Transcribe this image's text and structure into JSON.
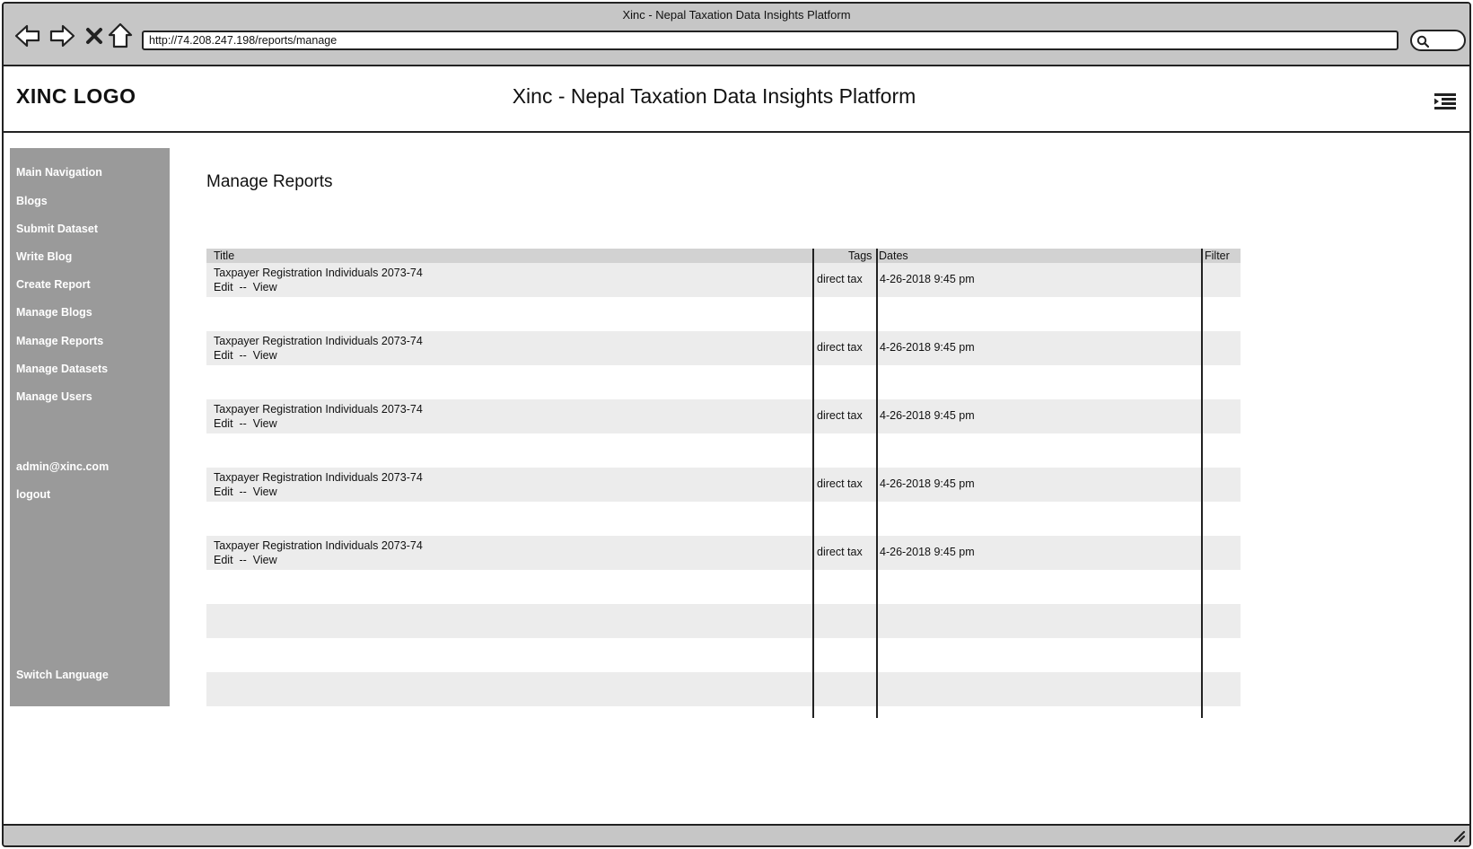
{
  "browser": {
    "window_title": "Xinc - Nepal Taxation Data Insights Platform",
    "url": "http://74.208.247.198/reports/manage",
    "icons": [
      "back-arrow-icon",
      "forward-arrow-icon",
      "stop-icon",
      "home-icon",
      "search-icon"
    ]
  },
  "header": {
    "logo": "XINC LOGO",
    "title": "Xinc - Nepal Taxation Data Insights Platform",
    "menu_icon": "menu-list-icon"
  },
  "sidebar": {
    "items": [
      {
        "label": "Main Navigation"
      },
      {
        "label": "Blogs"
      },
      {
        "label": "Submit Dataset"
      },
      {
        "label": "Write Blog"
      },
      {
        "label": "Create Report"
      },
      {
        "label": "Manage Blogs"
      },
      {
        "label": "Manage Reports"
      },
      {
        "label": "Manage Datasets"
      },
      {
        "label": "Manage Users"
      }
    ],
    "user_email": "admin@xinc.com",
    "logout": "logout",
    "switch_language": "Switch Language"
  },
  "main": {
    "page_title": "Manage Reports",
    "table": {
      "columns": {
        "title": "Title",
        "tags": "Tags",
        "dates": "Dates",
        "filter": "Filter"
      },
      "rows": [
        {
          "title": "Taxpayer Registration Individuals 2073-74",
          "edit": "Edit",
          "sep": "--",
          "view": "View",
          "tags": "direct tax",
          "date": "4-26-2018 9:45 pm"
        },
        {
          "title": "Taxpayer Registration Individuals 2073-74",
          "edit": "Edit",
          "sep": "--",
          "view": "View",
          "tags": "direct tax",
          "date": "4-26-2018 9:45 pm"
        },
        {
          "title": "Taxpayer Registration Individuals 2073-74",
          "edit": "Edit",
          "sep": "--",
          "view": "View",
          "tags": "direct tax",
          "date": "4-26-2018 9:45 pm"
        },
        {
          "title": "Taxpayer Registration Individuals 2073-74",
          "edit": "Edit",
          "sep": "--",
          "view": "View",
          "tags": "direct tax",
          "date": "4-26-2018 9:45 pm"
        },
        {
          "title": "Taxpayer Registration Individuals 2073-74",
          "edit": "Edit",
          "sep": "--",
          "view": "View",
          "tags": "direct tax",
          "date": "4-26-2018 9:45 pm"
        }
      ]
    }
  },
  "colors": {
    "chrome": "#c6c6c6",
    "sidebar": "#9a9a9a",
    "table_header": "#d2d2d2",
    "row_fill": "#ececec",
    "sidebar_text": "#ffffff"
  }
}
